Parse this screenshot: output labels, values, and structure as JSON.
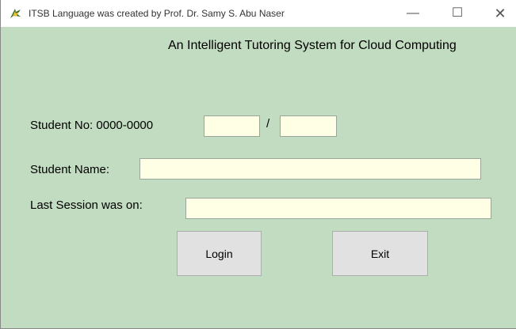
{
  "window": {
    "title": "ITSB Language was created by Prof. Dr. Samy S. Abu Naser"
  },
  "controls": {
    "minimize": "—",
    "maximize": "☐",
    "close": "✕"
  },
  "heading": "An Intelligent Tutoring System for Cloud Computing",
  "form": {
    "student_no_label": "Student No: 0000-0000",
    "separator": "/",
    "student_no_part1": "",
    "student_no_part2": "",
    "student_name_label": "Student Name:",
    "student_name": "",
    "last_session_label": "Last Session was on:",
    "last_session": ""
  },
  "buttons": {
    "login": "Login",
    "exit": "Exit"
  },
  "colors": {
    "background": "#c2dcc1",
    "field": "#ffffe5",
    "button": "#e1e1e1"
  }
}
